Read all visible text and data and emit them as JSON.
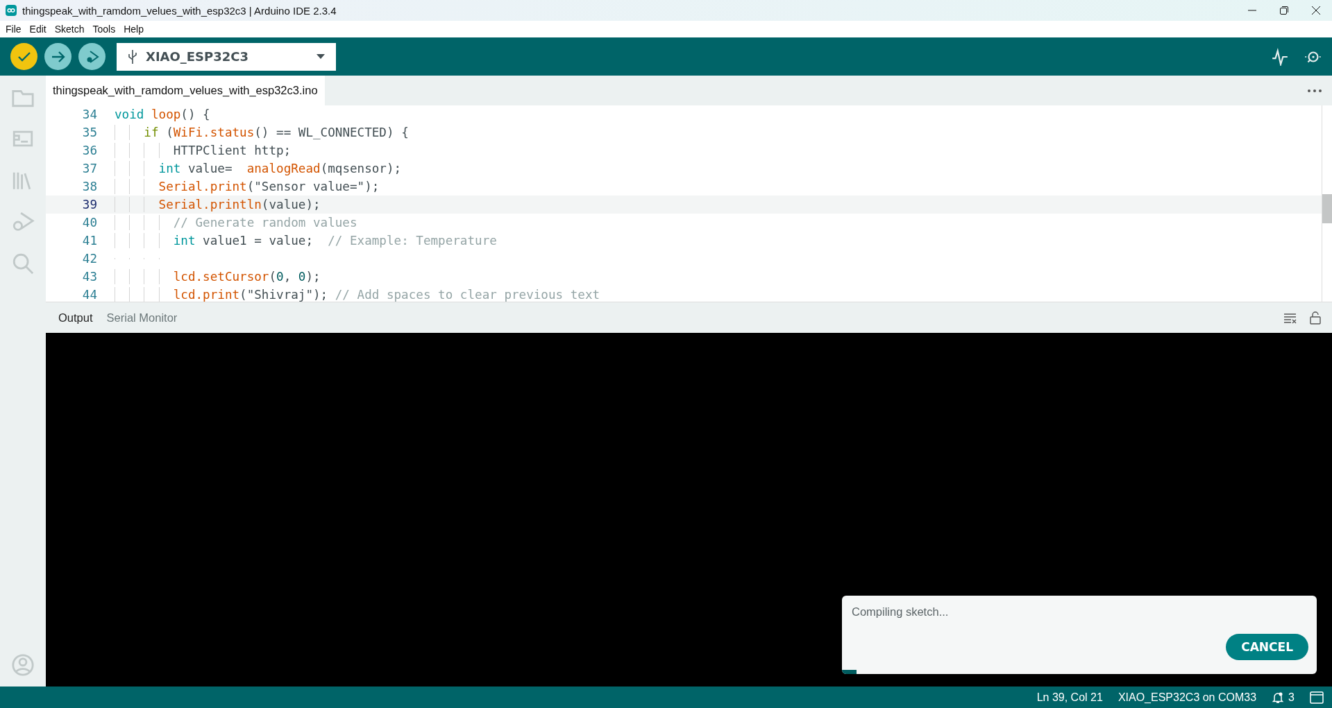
{
  "window": {
    "title": "thingspeak_with_ramdom_velues_with_esp32c3 | Arduino IDE 2.3.4"
  },
  "menu": [
    "File",
    "Edit",
    "Sketch",
    "Tools",
    "Help"
  ],
  "toolbar": {
    "board": "XIAO_ESP32C3"
  },
  "editor_tab": {
    "label": "thingspeak_with_ramdom_velues_with_esp32c3.ino",
    "selected": true
  },
  "code_lines": [
    {
      "number": "34",
      "current": false,
      "tokens": [
        {
          "kind": "keyword",
          "text": "void"
        },
        {
          "kind": "function",
          "text": " loop"
        },
        {
          "kind": "plain",
          "text": "() {"
        }
      ]
    },
    {
      "number": "35",
      "current": false,
      "tokens": [
        {
          "kind": "control",
          "text": "    if"
        },
        {
          "kind": "plain",
          "text": " ("
        },
        {
          "kind": "function",
          "text": "WiFi.status"
        },
        {
          "kind": "plain",
          "text": "() == WL_CONNECTED) {"
        }
      ]
    },
    {
      "number": "36",
      "current": false,
      "tokens": [
        {
          "kind": "plain",
          "text": "        HTTPClient http;"
        }
      ]
    },
    {
      "number": "37",
      "current": false,
      "tokens": [
        {
          "kind": "keyword",
          "text": "      int"
        },
        {
          "kind": "plain",
          "text": " value=  "
        },
        {
          "kind": "function",
          "text": "analogRead"
        },
        {
          "kind": "plain",
          "text": "(mqsensor);"
        }
      ]
    },
    {
      "number": "38",
      "current": false,
      "tokens": [
        {
          "kind": "function",
          "text": "      Serial.print"
        },
        {
          "kind": "plain",
          "text": "(\"Sensor value=\");"
        }
      ]
    },
    {
      "number": "39",
      "current": true,
      "tokens": [
        {
          "kind": "function",
          "text": "      Serial.println"
        },
        {
          "kind": "plain",
          "text": "(value);"
        }
      ]
    },
    {
      "number": "40",
      "current": false,
      "tokens": [
        {
          "kind": "comment",
          "text": "        // Generate random values"
        }
      ]
    },
    {
      "number": "41",
      "current": false,
      "tokens": [
        {
          "kind": "keyword",
          "text": "        int"
        },
        {
          "kind": "plain",
          "text": " value1 = value;  "
        },
        {
          "kind": "comment",
          "text": "// Example: Temperature"
        }
      ]
    },
    {
      "number": "42",
      "current": false
    },
    {
      "number": "43",
      "current": false,
      "tokens": [
        {
          "kind": "function",
          "text": "        lcd.setCursor"
        },
        {
          "kind": "plain",
          "text": "("
        },
        {
          "kind": "number",
          "text": "0"
        },
        {
          "kind": "plain",
          "text": ", "
        },
        {
          "kind": "number",
          "text": "0"
        },
        {
          "kind": "plain",
          "text": ");"
        }
      ]
    },
    {
      "number": "44",
      "current": false,
      "tokens": [
        {
          "kind": "function",
          "text": "        lcd.print"
        },
        {
          "kind": "plain",
          "text": "(\"Shivraj\"); "
        },
        {
          "kind": "comment",
          "text": "// Add spaces to clear previous text"
        }
      ]
    }
  ],
  "panel_tabs": [
    {
      "label": "Output",
      "selected": true
    },
    {
      "label": "Serial Monitor",
      "selected": false
    }
  ],
  "notification": {
    "message": "Compiling sketch...",
    "button": "CANCEL",
    "level": 0.03
  },
  "status_bar": {
    "position": "Ln 39, Col 21",
    "board": "XIAO_ESP32C3 on COM33",
    "notifications": "3"
  }
}
